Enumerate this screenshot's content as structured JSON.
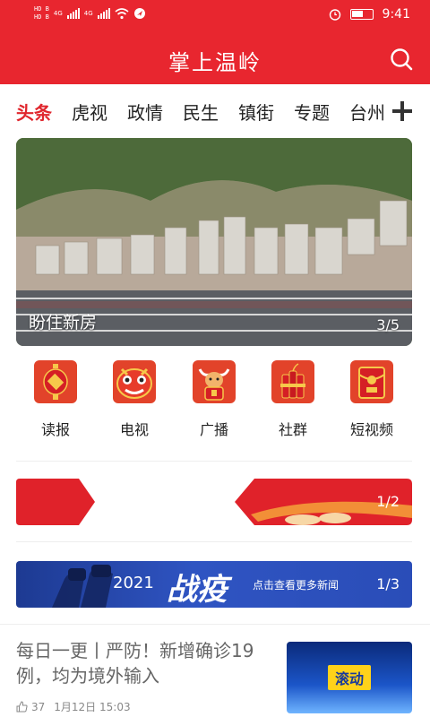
{
  "status_bar": {
    "sim1": "HD B",
    "sim2": "HD B",
    "net1": "4G",
    "net2": "4G",
    "time": "9:41",
    "icons": [
      "signal-icon",
      "wifi-icon",
      "location-icon",
      "alarm-icon",
      "battery-icon"
    ]
  },
  "header": {
    "title": "掌上温岭",
    "search_icon": "search-icon"
  },
  "tabs": [
    {
      "label": "头条",
      "active": true
    },
    {
      "label": "虎视",
      "active": false
    },
    {
      "label": "政情",
      "active": false
    },
    {
      "label": "民生",
      "active": false
    },
    {
      "label": "镇街",
      "active": false
    },
    {
      "label": "专题",
      "active": false
    },
    {
      "label": "台州",
      "active": false
    }
  ],
  "banner": {
    "caption": "盼住新房",
    "page": "3/5"
  },
  "quick_links": [
    {
      "label": "读报",
      "icon": "lantern-icon"
    },
    {
      "label": "电视",
      "icon": "lion-dance-icon"
    },
    {
      "label": "广播",
      "icon": "ox-icon"
    },
    {
      "label": "社群",
      "icon": "firecracker-icon"
    },
    {
      "label": "短视频",
      "icon": "red-envelope-icon"
    }
  ],
  "promo": {
    "page": "1/2"
  },
  "campaign": {
    "year": "2021",
    "title": "战疫",
    "link": "点击查看更多新闻",
    "page": "1/3"
  },
  "news": {
    "title": "每日一更丨严防！新增确诊19例，均为境外输入",
    "likes": "37",
    "date": "1月12日 15:03",
    "thumb_label": "滚动"
  },
  "colors": {
    "brand_red": "#e8262f",
    "active_tab": "#e0262d",
    "campaign_blue": "#2f54c2"
  }
}
